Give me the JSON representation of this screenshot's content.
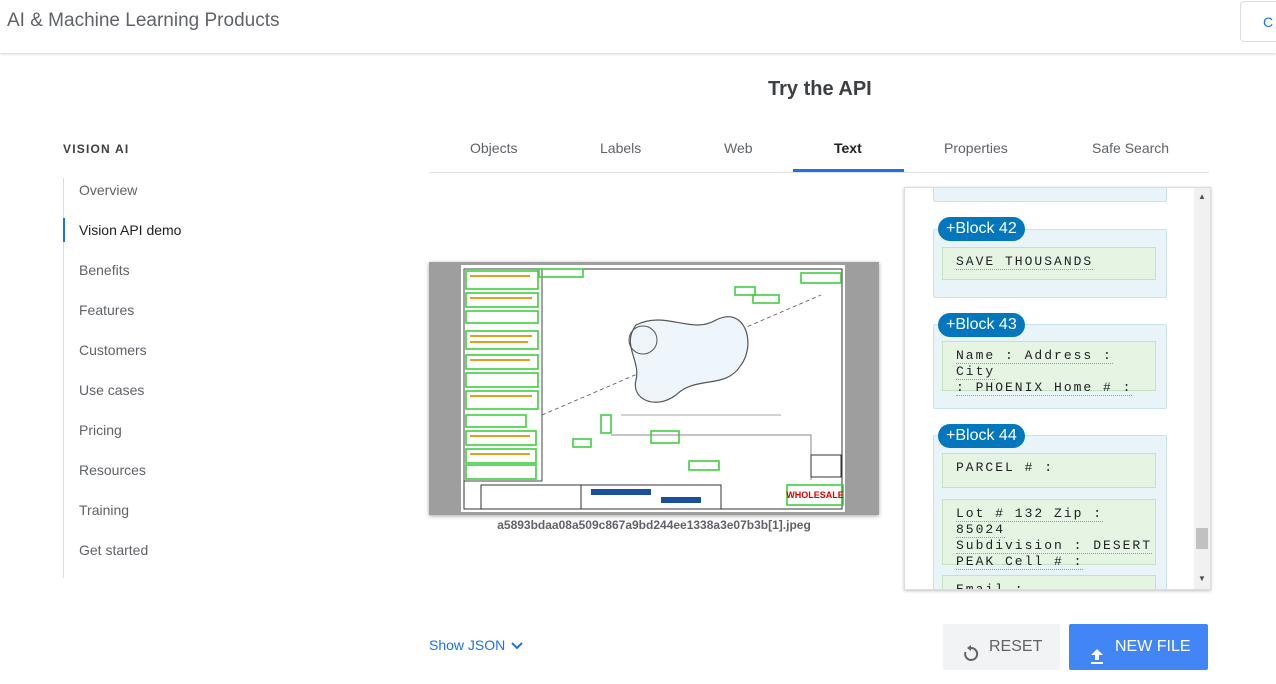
{
  "header": {
    "title": "AI & Machine Learning Products",
    "right_button": "C"
  },
  "sidebar": {
    "heading": "VISION AI",
    "items": [
      {
        "label": "Overview"
      },
      {
        "label": "Vision API demo"
      },
      {
        "label": "Benefits"
      },
      {
        "label": "Features"
      },
      {
        "label": "Customers"
      },
      {
        "label": "Use cases"
      },
      {
        "label": "Pricing"
      },
      {
        "label": "Resources"
      },
      {
        "label": "Training"
      },
      {
        "label": "Get started"
      }
    ]
  },
  "main": {
    "title": "Try the API",
    "tabs": [
      {
        "label": "Objects"
      },
      {
        "label": "Labels"
      },
      {
        "label": "Web"
      },
      {
        "label": "Text"
      },
      {
        "label": "Properties"
      },
      {
        "label": "Safe Search"
      }
    ],
    "active_tab": "Text",
    "image": {
      "filename": "a5893bdaa08a509c867a9bd244ee1338a3e07b3b[1].jpeg",
      "sign_text": "WHOLESALE"
    },
    "blocks": [
      {
        "label": "+Block 42",
        "lines": [
          "SAVE THOUSANDS"
        ]
      },
      {
        "label": "+Block 43",
        "lines": [
          "Name : Address : City",
          ": PHOENIX Home # :"
        ]
      },
      {
        "label": "+Block 44",
        "lines": [
          "PARCEL # :",
          "Lot # 132 Zip : 85024",
          "Subdivision : DESERT",
          "PEAK Cell # :",
          "Email :"
        ]
      }
    ]
  },
  "actions": {
    "show_json": "Show JSON",
    "reset": "RESET",
    "new_file": "NEW FILE"
  },
  "colors": {
    "accent": "#1a73e8",
    "block_label": "#0277bd",
    "primary_button": "#4285f4"
  },
  "icons": [
    "chevron-down-icon",
    "reset-icon",
    "upload-icon",
    "scroll-up-icon",
    "scroll-down-icon"
  ]
}
